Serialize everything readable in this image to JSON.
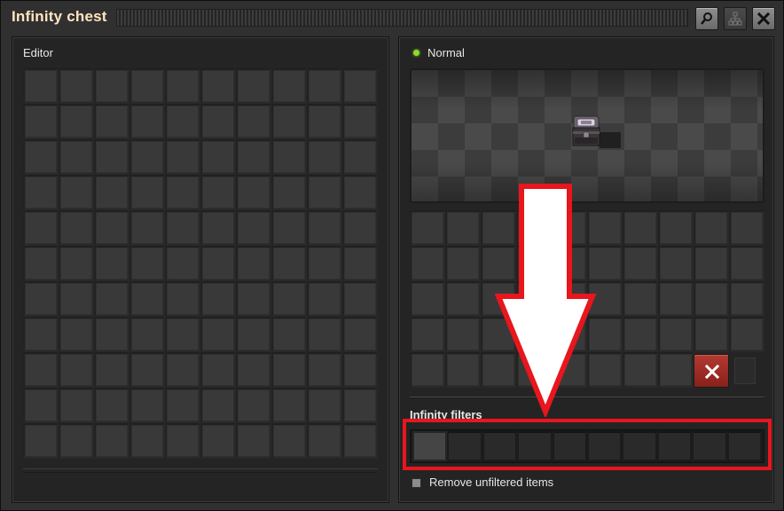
{
  "window": {
    "title": "Infinity chest"
  },
  "titlebar_buttons": [
    {
      "name": "search",
      "icon": "search-icon"
    },
    {
      "name": "circuit-network",
      "icon": "network-icon"
    },
    {
      "name": "close",
      "icon": "close-icon"
    }
  ],
  "editor": {
    "label": "Editor",
    "rows": 11,
    "columns": 10
  },
  "status": {
    "text": "Normal",
    "color": "#8bdd2b"
  },
  "inventory": {
    "rows": 5,
    "columns": 10,
    "delete_button_icon": "close-icon",
    "delete_button_color": "#a02c25"
  },
  "infinity_filters": {
    "label": "Infinity filters",
    "slot_count": 10
  },
  "remove_unfiltered": {
    "label": "Remove unfiltered items",
    "checked": false
  },
  "annotation": {
    "highlight_color": "#e8161d",
    "arrow_color": "#ffffff"
  }
}
